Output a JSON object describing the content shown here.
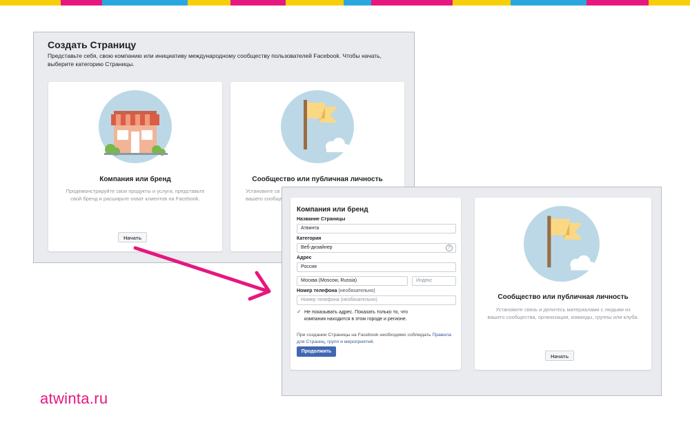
{
  "colors": {
    "stripe": [
      "#f7cf09",
      "#e6177f",
      "#2aa7de",
      "#f7cf09",
      "#e6177f",
      "#f7cf09",
      "#2aa7de",
      "#e6177f",
      "#f7cf09",
      "#2aa7de",
      "#e6177f",
      "#f7cf09"
    ],
    "accent": "#e6177f",
    "primary_button": "#4267b2",
    "link": "#365899"
  },
  "create_page": {
    "title": "Создать Страницу",
    "description": "Представьте себя, свою компанию или инициативу международному сообществу пользователей Facebook. Чтобы начать, выберите категорию Страницы.",
    "cards": [
      {
        "title": "Компания или бренд",
        "description": "Продемонстрируйте свои продукты и услуги, представьте свой бренд и расширьте охват клиентов на Facebook.",
        "button": "Начать",
        "icon": "storefront-icon"
      },
      {
        "title": "Сообщество или публичная личность",
        "description": "Установите св",
        "description_line2": "вашего сообще",
        "icon": "flag-icon"
      }
    ]
  },
  "form": {
    "title": "Компания или бренд",
    "page_name_label": "Название Страницы",
    "page_name_value": "Атвинта",
    "category_label": "Категория",
    "category_value": "Веб-дизайнер",
    "category_help": "?",
    "address_label": "Адрес",
    "country_value": "Россия",
    "city_value": "Москва (Moscow, Russia)",
    "zip_placeholder": "Индекс",
    "phone_label": "Номер телефона",
    "phone_optional": "(необязательно)",
    "phone_placeholder": "Номер телефона (необязательно)",
    "hide_address_checked": true,
    "hide_address_text": "Не показывать адрес. Показать только то, что компания находится в этом городе и регионе.",
    "terms_text": "При создании Страницы на Facebook необходимо соблюдать",
    "terms_link": "Правила для Страниц, групп и мероприятий",
    "terms_end": ".",
    "continue_button": "Продолжить"
  },
  "community_card": {
    "title": "Сообщество или публичная личность",
    "description": "Установите связь и делитесь материалами с людьми из вашего сообщества, организации, команды, группы или клуба.",
    "button": "Начать",
    "icon": "flag-icon"
  },
  "brand": "atwinta.ru",
  "glyphs": {
    "check": "✓"
  }
}
